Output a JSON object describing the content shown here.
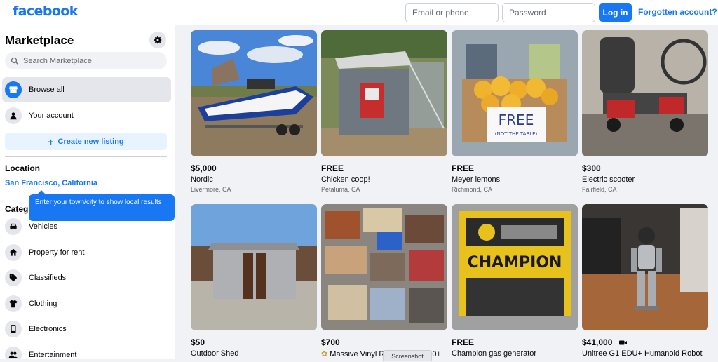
{
  "brand": {
    "logo_text": "facebook",
    "accent_color": "#1877f2"
  },
  "header": {
    "email_placeholder": "Email or phone",
    "password_placeholder": "Password",
    "login_label": "Log in",
    "forgot_label": "Forgotten account?"
  },
  "sidebar": {
    "title": "Marketplace",
    "settings_icon": "gear-icon",
    "search_placeholder": "Search Marketplace",
    "nav": [
      {
        "label": "Browse all",
        "icon": "storefront-icon",
        "active": true
      },
      {
        "label": "Your account",
        "icon": "person-icon",
        "active": false
      }
    ],
    "create_label": "Create new listing",
    "location_title": "Location",
    "location_value": "San Francisco, California",
    "tooltip": "Enter your town/city to show local results",
    "categories_title": "Categ",
    "categories": [
      {
        "label": "Vehicles",
        "icon": "car-icon"
      },
      {
        "label": "Property for rent",
        "icon": "house-icon"
      },
      {
        "label": "Classifieds",
        "icon": "tag-icon"
      },
      {
        "label": "Clothing",
        "icon": "shirt-icon"
      },
      {
        "label": "Electronics",
        "icon": "phone-icon"
      },
      {
        "label": "Entertainment",
        "icon": "people-icon"
      }
    ]
  },
  "listings": [
    {
      "price": "$5,000",
      "name": "Nordic",
      "location": "Livermore, CA",
      "photo": "boat"
    },
    {
      "price": "FREE",
      "name": "Chicken coop!",
      "location": "Petaluma, CA",
      "photo": "coop"
    },
    {
      "price": "FREE",
      "name": "Meyer lemons",
      "location": "Richmond, CA",
      "photo": "lemons"
    },
    {
      "price": "$300",
      "name": "Electric scooter",
      "location": "Fairfield, CA",
      "photo": "scooter"
    },
    {
      "price": "$50",
      "name": "Outdoor Shed",
      "location": "",
      "photo": "shed"
    },
    {
      "price": "$700",
      "name": "Massive Vinyl R",
      "name_tail": "0+",
      "location": "",
      "photo": "vinyl"
    },
    {
      "price": "FREE",
      "name": "Champion gas generator",
      "location": "",
      "photo": "generator"
    },
    {
      "price": "$41,000",
      "name": "Unitree G1 EDU+ Humanoid Robot",
      "location": "",
      "photo": "robot"
    }
  ],
  "photo_text": {
    "lemons_sign": "FREE",
    "lemons_sign_sub": "(NOT THE TABLE)",
    "generator_brand": "CHAMPION"
  },
  "overlay": {
    "screenshot_label": "Screenshot"
  }
}
